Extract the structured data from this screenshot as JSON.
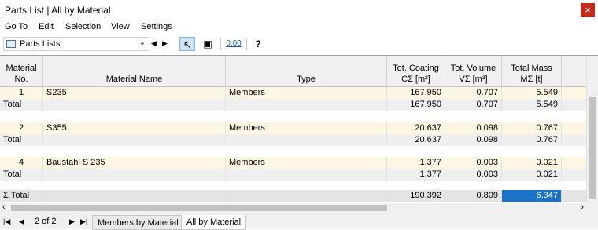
{
  "window": {
    "title": "Parts List | All by Material",
    "close": "×"
  },
  "menu": [
    "Go To",
    "Edit",
    "Selection",
    "View",
    "Settings"
  ],
  "toolbar": {
    "combo_label": "Parts Lists",
    "decimals": "0,00"
  },
  "columns": {
    "no": [
      "Material",
      "No."
    ],
    "name": "Material Name",
    "type": "Type",
    "coating": [
      "Tot. Coating",
      "CΣ [m²]"
    ],
    "volume": [
      "Tot. Volume",
      "VΣ [m³]"
    ],
    "mass": [
      "Total Mass",
      "MΣ [t]"
    ]
  },
  "rows": [
    {
      "no": "1",
      "name": "S235",
      "type": "Members",
      "coating": "167.950",
      "volume": "0.707",
      "mass": "5.549"
    },
    {
      "no": "Total",
      "name": "",
      "type": "",
      "coating": "167.950",
      "volume": "0.707",
      "mass": "5.549"
    },
    {
      "no": "2",
      "name": "S355",
      "type": "Members",
      "coating": "20.637",
      "volume": "0.098",
      "mass": "0.767"
    },
    {
      "no": "Total",
      "name": "",
      "type": "",
      "coating": "20.637",
      "volume": "0.098",
      "mass": "0.767"
    },
    {
      "no": "4",
      "name": "Baustahl S 235",
      "type": "Members",
      "coating": "1.377",
      "volume": "0.003",
      "mass": "0.021"
    },
    {
      "no": "Total",
      "name": "",
      "type": "",
      "coating": "1.377",
      "volume": "0.003",
      "mass": "0.021"
    },
    {
      "no": "Σ Total",
      "name": "",
      "type": "",
      "coating": "190.392",
      "volume": "0.809",
      "mass": "6.347"
    }
  ],
  "pager": {
    "page": "2 of 2"
  },
  "tabs": [
    "Members by Material",
    "All by Material"
  ],
  "colors": {
    "selection": "#1a73c8",
    "row_highlight": "#fdf6e3",
    "close": "#c42b1c"
  }
}
